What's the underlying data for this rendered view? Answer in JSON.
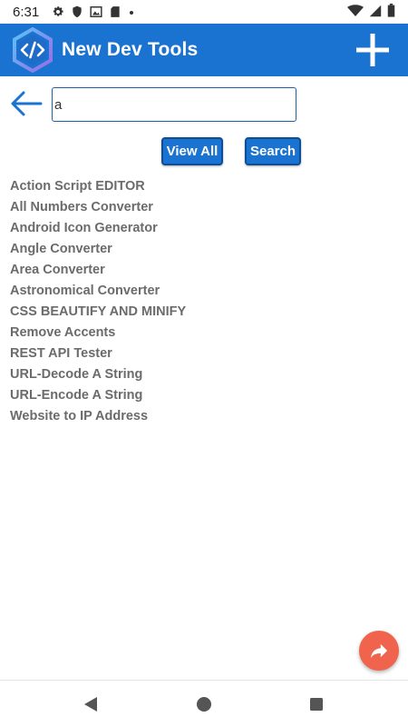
{
  "status_bar": {
    "time": "6:31",
    "left_icons": [
      "gear-icon",
      "shield-icon",
      "image-icon",
      "sd-card-icon",
      "dot-icon"
    ],
    "right_icons": [
      "wifi-icon",
      "signal-icon",
      "battery-icon"
    ]
  },
  "app_bar": {
    "title": "New Dev Tools",
    "logo_icon": "code-hexagon-icon",
    "add_icon": "plus-icon",
    "background_color": "#1a73d1"
  },
  "search": {
    "value": "a",
    "back_icon": "arrow-left-icon"
  },
  "buttons": {
    "view_all": "View All",
    "search": "Search"
  },
  "results": [
    "Action Script EDITOR",
    "All Numbers Converter",
    "Android Icon Generator",
    "Angle Converter",
    "Area Converter",
    "Astronomical Converter",
    "CSS BEAUTIFY AND MINIFY",
    "Remove Accents",
    "REST API Tester",
    "URL-Decode A String",
    "URL-Encode A String",
    "Website to IP Address"
  ],
  "fab": {
    "icon": "share-arrow-icon",
    "color": "#f0644e"
  },
  "nav_bar": {
    "icons": [
      "back-triangle-icon",
      "home-circle-icon",
      "recents-square-icon"
    ]
  }
}
